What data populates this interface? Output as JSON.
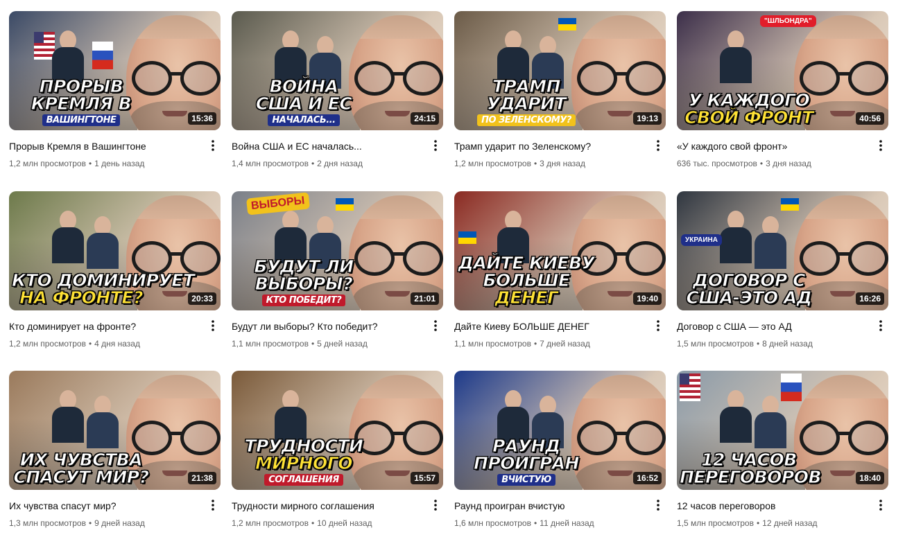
{
  "videos": [
    {
      "title": "Прорыв Кремля в Вашингтоне",
      "views": "1,2 млн просмотров",
      "age": "1 день назад",
      "duration": "15:36",
      "thumb_lines": [
        "ПРОРЫВ",
        "КРЕМЛЯ В"
      ],
      "thumb_sub": "ВАШИНГТОНЕ",
      "thumb_bg": "#3b4a66",
      "thumb_accent": "#1f2f8a",
      "icon": "more-vert-icon"
    },
    {
      "title": "Война США и ЕС началась...",
      "views": "1,4 млн просмотров",
      "age": "2 дня назад",
      "duration": "24:15",
      "thumb_lines": [
        "ВОЙНА",
        "США И ЕС"
      ],
      "thumb_sub": "НАЧАЛАСЬ...",
      "thumb_bg": "#5a5a4e",
      "thumb_accent": "#1f2f8a",
      "icon": "more-vert-icon"
    },
    {
      "title": "Трамп ударит по Зеленскому?",
      "views": "1,2 млн просмотров",
      "age": "3 дня назад",
      "duration": "19:13",
      "thumb_lines": [
        "ТРАМП",
        "УДАРИТ"
      ],
      "thumb_sub": "ПО ЗЕЛЕНСКОМУ?",
      "thumb_bg": "#6b5b48",
      "thumb_accent": "#f2c21b",
      "icon": "more-vert-icon"
    },
    {
      "title": "«У каждого свой фронт»",
      "views": "636 тыс. просмотров",
      "age": "3 дня назад",
      "duration": "40:56",
      "thumb_lines": [
        "У КАЖДОГО",
        "СВОЙ ФРОНТ"
      ],
      "thumb_sub": "",
      "thumb_label": "\"ШЛЬОНДРА\"",
      "thumb_bg": "#3c2f4a",
      "thumb_accent": "#ffe234",
      "icon": "more-vert-icon"
    },
    {
      "title": "Кто доминирует на фронте?",
      "views": "1,2 млн просмотров",
      "age": "4 дня назад",
      "duration": "20:33",
      "thumb_lines": [
        "КТО ДОМИНИРУЕТ",
        "НА ФРОНТЕ?"
      ],
      "thumb_sub": "",
      "thumb_bg": "#6d7a4b",
      "thumb_accent": "#ffe234",
      "icon": "more-vert-icon"
    },
    {
      "title": "Будут ли выборы? Кто победит?",
      "views": "1,1 млн просмотров",
      "age": "5 дней назад",
      "duration": "21:01",
      "thumb_lines": [
        "БУДУТ ЛИ",
        "ВЫБОРЫ?"
      ],
      "thumb_sub": "КТО ПОБЕДИТ?",
      "thumb_label": "ВЫБОРЫ",
      "thumb_bg": "#7a7f88",
      "thumb_accent": "#c01a2b",
      "icon": "more-vert-icon"
    },
    {
      "title": "Дайте Киеву БОЛЬШЕ ДЕНЕГ",
      "views": "1,1 млн просмотров",
      "age": "7 дней назад",
      "duration": "19:40",
      "thumb_lines": [
        "ДАЙТЕ КИЕВУ",
        "БОЛЬШЕ",
        "ДЕНЕГ"
      ],
      "thumb_sub": "",
      "thumb_bg": "#8a2a22",
      "thumb_accent": "#ffc21b",
      "icon": "more-vert-icon"
    },
    {
      "title": "Договор с США — это АД",
      "views": "1,5 млн просмотров",
      "age": "8 дней назад",
      "duration": "16:26",
      "thumb_lines": [
        "ДОГОВОР С",
        "США-ЭТО АД"
      ],
      "thumb_sub": "",
      "thumb_label": "УКРАИНА",
      "thumb_bg": "#2f3640",
      "thumb_accent": "#2e8b3c",
      "icon": "more-vert-icon"
    },
    {
      "title": "Их чувства спасут мир?",
      "views": "1,3 млн просмотров",
      "age": "9 дней назад",
      "duration": "21:38",
      "thumb_lines": [
        "ИХ ЧУВСТВА",
        "СПАСУТ МИР?"
      ],
      "thumb_sub": "",
      "thumb_bg": "#9a7a5c",
      "thumb_accent": "#e11d48",
      "icon": "more-vert-icon"
    },
    {
      "title": "Трудности мирного соглашения",
      "views": "1,2 млн просмотров",
      "age": "10 дней назад",
      "duration": "15:57",
      "thumb_lines": [
        "ТРУДНОСТИ",
        "МИРНОГО"
      ],
      "thumb_sub": "СОГЛАШЕНИЯ",
      "thumb_bg": "#7a5a3a",
      "thumb_accent": "#c01a2b",
      "icon": "more-vert-icon"
    },
    {
      "title": "Раунд проигран вчистую",
      "views": "1,6 млн просмотров",
      "age": "11 дней назад",
      "duration": "16:52",
      "thumb_lines": [
        "РАУНД",
        "ПРОИГРАН"
      ],
      "thumb_sub": "ВЧИСТУЮ",
      "thumb_bg": "#1d3a8a",
      "thumb_accent": "#1f2f8a",
      "icon": "more-vert-icon"
    },
    {
      "title": "12 часов переговоров",
      "views": "1,5 млн просмотров",
      "age": "12 дней назад",
      "duration": "18:40",
      "thumb_lines": [
        "12 ЧАСОВ",
        "ПЕРЕГОВОРОВ"
      ],
      "thumb_sub": "",
      "thumb_bg": "#8a9aa8",
      "thumb_accent": "#c01a2b",
      "icon": "more-vert-icon"
    }
  ],
  "separator": "•"
}
